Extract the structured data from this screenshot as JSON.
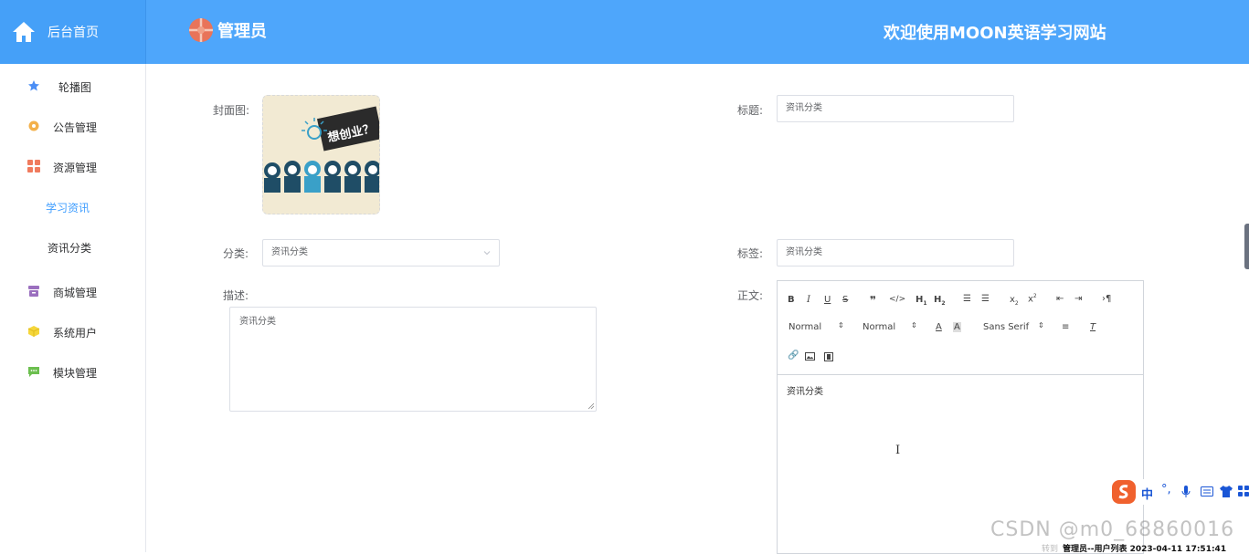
{
  "header": {
    "home_label": "后台首页",
    "admin_name": "管理员",
    "welcome": "欢迎使用MOON英语学习网站",
    "brand_color": "#4ea6fb"
  },
  "sidebar": {
    "items": [
      {
        "label": "轮播图",
        "icon": "star-icon"
      },
      {
        "label": "公告管理",
        "icon": "gear-icon"
      },
      {
        "label": "资源管理",
        "icon": "grid-icon"
      },
      {
        "label": "商城管理",
        "icon": "archive-icon"
      },
      {
        "label": "系统用户",
        "icon": "cube-icon"
      },
      {
        "label": "模块管理",
        "icon": "chat-icon"
      }
    ],
    "sub_items": [
      {
        "label": "学习资讯",
        "active": true
      },
      {
        "label": "资讯分类",
        "active": false
      }
    ]
  },
  "form": {
    "cover_label": "封面图:",
    "cover_image_text": "想创业？",
    "title_label": "标题:",
    "title_value": "资讯分类",
    "category_label": "分类:",
    "category_value": "资讯分类",
    "tags_label": "标签:",
    "tags_value": "资讯分类",
    "desc_label": "描述:",
    "desc_value": "资讯分类",
    "body_label": "正文:"
  },
  "editor": {
    "size_select_1": "Normal",
    "size_select_2": "Normal",
    "font_select": "Sans Serif",
    "content": "资讯分类"
  },
  "overlay": {
    "ime_lang": "中",
    "watermark": "CSDN @m0_68860016",
    "status_text": "管理员--用户列表 2023-04-11 17:51:41",
    "status_ghost": "转到"
  }
}
